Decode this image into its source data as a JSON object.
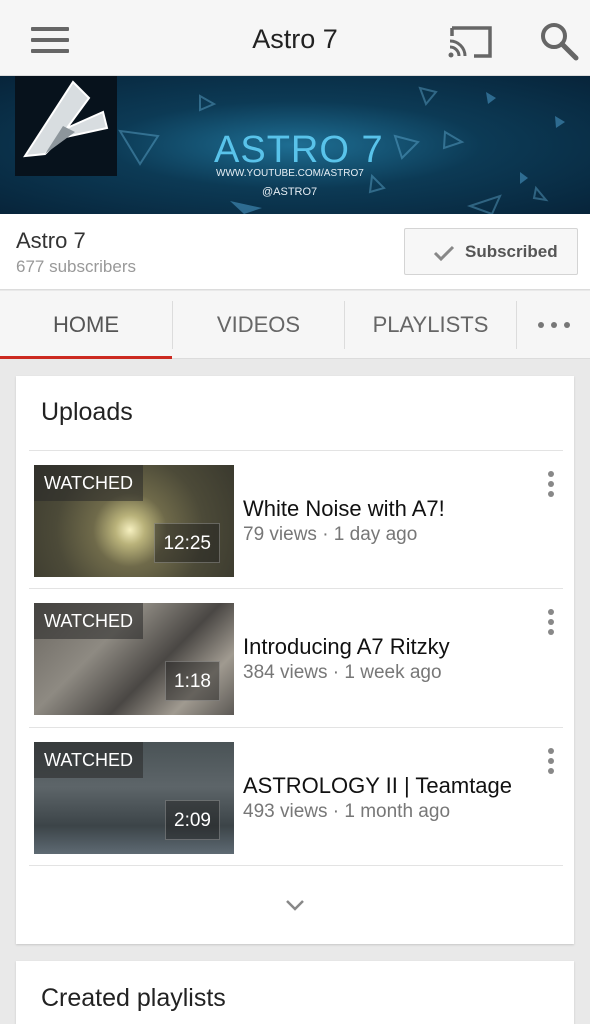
{
  "app_bar": {
    "title": "Astro 7",
    "menu_icon": "hamburger-menu-icon",
    "cast_icon": "cast-icon",
    "search_icon": "search-icon"
  },
  "banner": {
    "title": "ASTRO 7",
    "url": "WWW.YOUTUBE.COM/ASTRO7",
    "handle": "@ASTRO7",
    "accent_color": "#59c3ea"
  },
  "channel": {
    "name": "Astro 7",
    "subscribers": "677 subscribers",
    "subscribe_label": "Subscribed"
  },
  "tabs": [
    {
      "label": "HOME",
      "active": true
    },
    {
      "label": "VIDEOS",
      "active": false
    },
    {
      "label": "PLAYLISTS",
      "active": false
    }
  ],
  "tab_active_color": "#cc2a21",
  "uploads": {
    "title": "Uploads",
    "videos": [
      {
        "badge": "WATCHED",
        "duration": "12:25",
        "title": "White Noise with A7!",
        "meta": "79 views · 1 day ago"
      },
      {
        "badge": "WATCHED",
        "duration": "1:18",
        "title": "Introducing A7 Ritzky",
        "meta": "384 views · 1 week ago"
      },
      {
        "badge": "WATCHED",
        "duration": "2:09",
        "title": "ASTROLOGY II | Teamtage",
        "meta": "493 views · 1 month ago"
      }
    ]
  },
  "playlists": {
    "title": "Created playlists"
  }
}
